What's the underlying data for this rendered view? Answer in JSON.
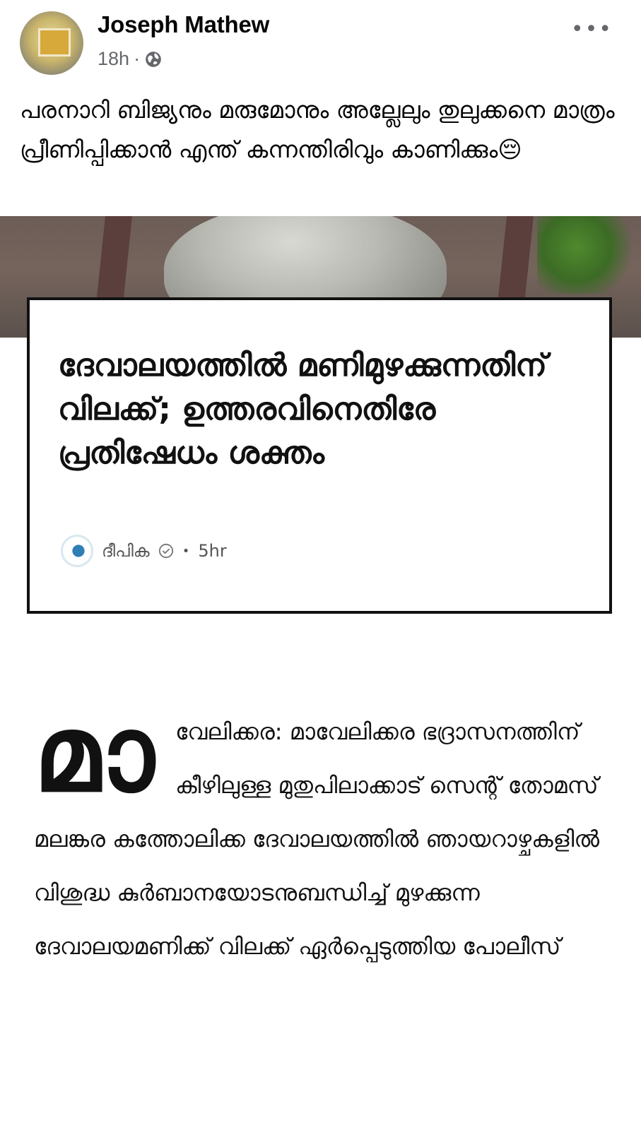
{
  "post": {
    "author": "Joseph Mathew",
    "time": "18h",
    "separator": "·",
    "audience_icon": "globe-icon",
    "more_label": "•••",
    "caption": "പരനാറി ബിജ്യനും മരുമോനും അല്ലേലും തുലുക്കനെ മാത്രം പ്രീണിപ്പിക്കാൻ എന്ത് കന്നന്തിരിവും കാണിക്കും😔"
  },
  "card": {
    "headline": "ദേവാലയത്തിൽ മണിമുഴക്കുന്നതിന് വിലക്ക്; ഉത്തരവിനെതിരേ പ്രതിഷേധം ശക്തം",
    "source": "ദീപിക",
    "bullet": "•",
    "age": "5hr"
  },
  "article": {
    "dropcap": "മാ",
    "body": "വേലിക്കര: മാവേലിക്കര ഭദ്രാസനത്തിന് കീഴിലുള്ള മുതുപിലാക്കാട് സെന്റ് തോമസ് മലങ്കര കത്തോലിക്ക ദേവാലയത്തിൽ ഞായറാഴ്ചകളിൽ വിശുദ്ധ കുർബാനയോടനുബന്ധിച്ച് മുഴക്കുന്ന ദേവാലയമണിക്ക് വിലക്ക് ഏർപ്പെടുത്തിയ പോലീസ്"
  }
}
